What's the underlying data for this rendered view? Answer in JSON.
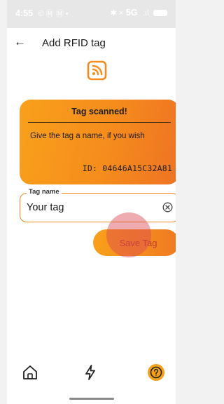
{
  "status_bar": {
    "time": "4:55",
    "left_glyphs": "© Ⓜ Ⓜ •",
    "right_glyphs": "✱ ×",
    "network": "5G",
    "signal_glyph": ".ıl"
  },
  "header": {
    "back_icon": "arrow-left-icon",
    "title": "Add RFID tag"
  },
  "scan_card": {
    "heading": "Tag scanned!",
    "message": "Give the tag a name, if you wish",
    "id_text": "ID: 04646A15C32A81"
  },
  "name_field": {
    "legend": "Tag name",
    "value": "Your tag",
    "clear_icon": "clear-circle-icon"
  },
  "save_button": {
    "label": "Save Tag"
  },
  "bottom_nav": {
    "items": [
      {
        "icon": "home-icon"
      },
      {
        "icon": "bolt-icon"
      },
      {
        "icon": "help-icon"
      }
    ]
  },
  "colors": {
    "accent": "#f58c1c",
    "accent_light": "#f9a01b",
    "accent_dark": "#ee7323",
    "button_text": "#c0392b",
    "status_bar_bg": "#e7e7e7"
  }
}
